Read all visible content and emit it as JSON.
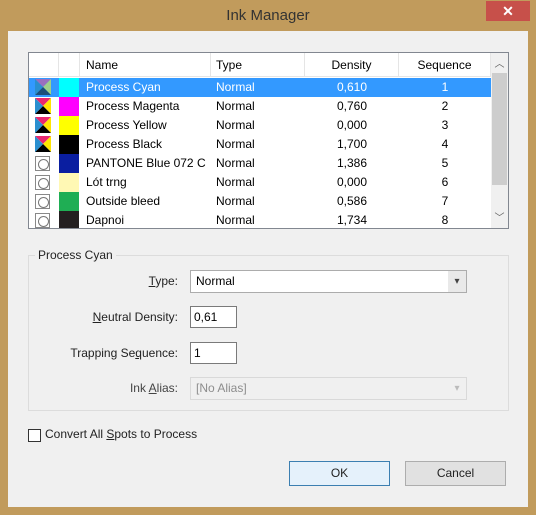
{
  "window": {
    "title": "Ink Manager",
    "close_icon": "close-icon"
  },
  "list": {
    "columns": [
      "Name",
      "Type",
      "Density",
      "Sequence"
    ],
    "rows": [
      {
        "icon": "process",
        "color": "#00ffff",
        "name": "Process Cyan",
        "type": "Normal",
        "density": "0,610",
        "sequence": "1",
        "selected": true
      },
      {
        "icon": "process",
        "color": "#ff00ff",
        "name": "Process Magenta",
        "type": "Normal",
        "density": "0,760",
        "sequence": "2"
      },
      {
        "icon": "process",
        "color": "#ffff00",
        "name": "Process Yellow",
        "type": "Normal",
        "density": "0,000",
        "sequence": "3"
      },
      {
        "icon": "process",
        "color": "#000000",
        "name": "Process Black",
        "type": "Normal",
        "density": "1,700",
        "sequence": "4"
      },
      {
        "icon": "spot",
        "color": "#0a1ea0",
        "name": "PANTONE Blue 072 C",
        "type": "Normal",
        "density": "1,386",
        "sequence": "5"
      },
      {
        "icon": "spot",
        "color": "#fff8b4",
        "name": "Lót trng",
        "type": "Normal",
        "density": "0,000",
        "sequence": "6"
      },
      {
        "icon": "spot",
        "color": "#1fae54",
        "name": "Outside bleed",
        "type": "Normal",
        "density": "0,586",
        "sequence": "7"
      },
      {
        "icon": "spot",
        "color": "#231f20",
        "name": "Dapnoi",
        "type": "Normal",
        "density": "1,734",
        "sequence": "8"
      }
    ]
  },
  "details": {
    "group_title": "Process Cyan",
    "type_label": {
      "pre": "",
      "key": "T",
      "post": "ype:"
    },
    "type_value": "Normal",
    "nd_label": {
      "pre": "",
      "key": "N",
      "post": "eutral Density:"
    },
    "nd_value": "0,61",
    "ts_label": {
      "pre": "Trapping Se",
      "key": "q",
      "post": "uence:"
    },
    "ts_value": "1",
    "alias_label": {
      "pre": "Ink ",
      "key": "A",
      "post": "lias:"
    },
    "alias_value": "[No Alias]"
  },
  "convert": {
    "pre": "Convert All ",
    "key": "S",
    "post": "pots to Process",
    "checked": false
  },
  "buttons": {
    "ok": "OK",
    "cancel": "Cancel"
  },
  "colors": {
    "selection": "#3399ff",
    "frame": "#c19b5c",
    "close": "#c7504a"
  }
}
